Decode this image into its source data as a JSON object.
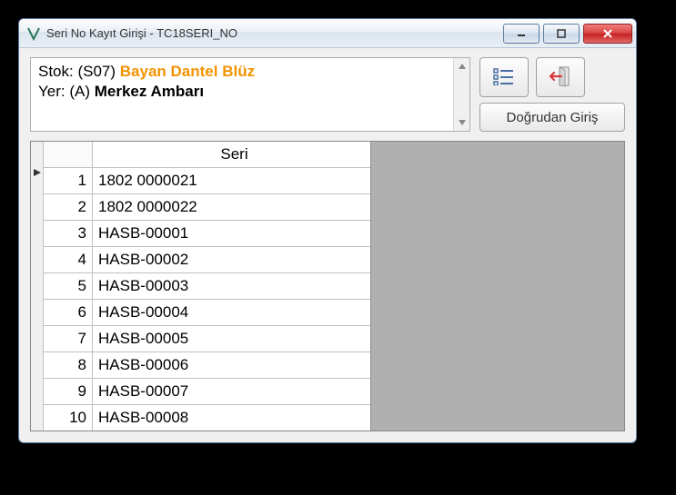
{
  "window": {
    "title": "Seri No Kayıt Girişi - TC18SERI_NO"
  },
  "info": {
    "stock_label": "Stok: (S07) ",
    "stock_name": "Bayan Dantel Blüz",
    "location_label": "Yer: (A) ",
    "location_name": "Merkez Ambarı"
  },
  "buttons": {
    "direct_entry": "Doğrudan Giriş"
  },
  "grid": {
    "header_serial": "Seri",
    "rows": [
      {
        "idx": "1",
        "serial": "1802  0000021"
      },
      {
        "idx": "2",
        "serial": "1802  0000022"
      },
      {
        "idx": "3",
        "serial": "HASB-00001"
      },
      {
        "idx": "4",
        "serial": "HASB-00002"
      },
      {
        "idx": "5",
        "serial": "HASB-00003"
      },
      {
        "idx": "6",
        "serial": "HASB-00004"
      },
      {
        "idx": "7",
        "serial": "HASB-00005"
      },
      {
        "idx": "8",
        "serial": "HASB-00006"
      },
      {
        "idx": "9",
        "serial": "HASB-00007"
      },
      {
        "idx": "10",
        "serial": "HASB-00008"
      }
    ]
  }
}
